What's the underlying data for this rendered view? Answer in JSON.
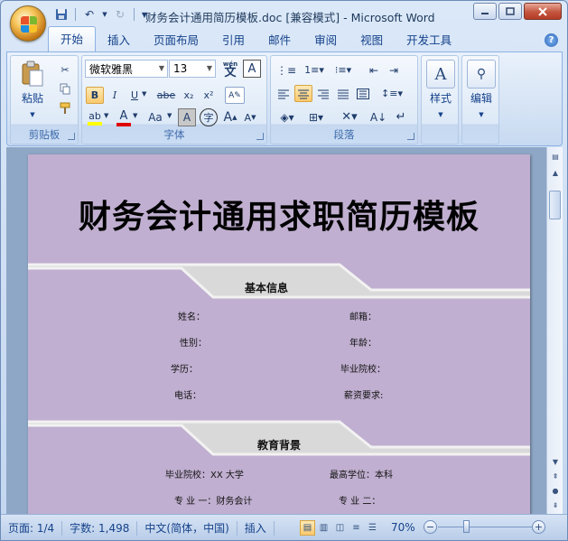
{
  "window": {
    "title": "财务会计通用简历模板.doc [兼容模式] - Microsoft Word"
  },
  "qat": {
    "save_icon": "save-icon",
    "undo_icon": "undo-icon",
    "redo_icon": "redo-icon",
    "customize_icon": "chevron-down-icon"
  },
  "tabs": [
    "开始",
    "插入",
    "页面布局",
    "引用",
    "邮件",
    "审阅",
    "视图",
    "开发工具"
  ],
  "ribbon": {
    "clipboard": {
      "label": "剪贴板",
      "paste_label": "粘贴"
    },
    "font": {
      "label": "字体",
      "font_name": "微软雅黑",
      "font_size": "13",
      "bold": "B",
      "italic": "I",
      "underline": "U",
      "strike": "abe",
      "subscript": "x₂",
      "superscript": "x²",
      "wen": "wén",
      "wen_char": "文",
      "char_border": "A",
      "font_color": "A",
      "change_case": "Aa",
      "grow": "A",
      "shrink": "A",
      "enclose": "字",
      "shade": "A"
    },
    "paragraph": {
      "label": "段落"
    },
    "styles": {
      "label": "样式"
    },
    "editing": {
      "label": "编辑"
    }
  },
  "document": {
    "title": "财务会计通用求职简历模板",
    "sections": [
      {
        "title": "基本信息",
        "fields_left": [
          "姓名：",
          "性别：",
          "学历：",
          "电话："
        ],
        "fields_right": [
          "邮箱：",
          "年龄：",
          "毕业院校：",
          "薪资要求:"
        ]
      },
      {
        "title": "教育背景",
        "fields_left": [
          "毕业院校：XX 大学",
          "专 业 一：财务会计"
        ],
        "fields_right": [
          "最高学位：本科",
          "专 业 二："
        ]
      }
    ]
  },
  "statusbar": {
    "page": "页面: 1/4",
    "words": "字数: 1,498",
    "language": "中文(简体，中国)",
    "mode": "插入",
    "zoom": "70%",
    "zoom_level_percent": 70
  },
  "colors": {
    "page_bg": "#c0afd0",
    "section_band": "#d9d9d9",
    "ribbon_bg": "#dbe8f8"
  }
}
